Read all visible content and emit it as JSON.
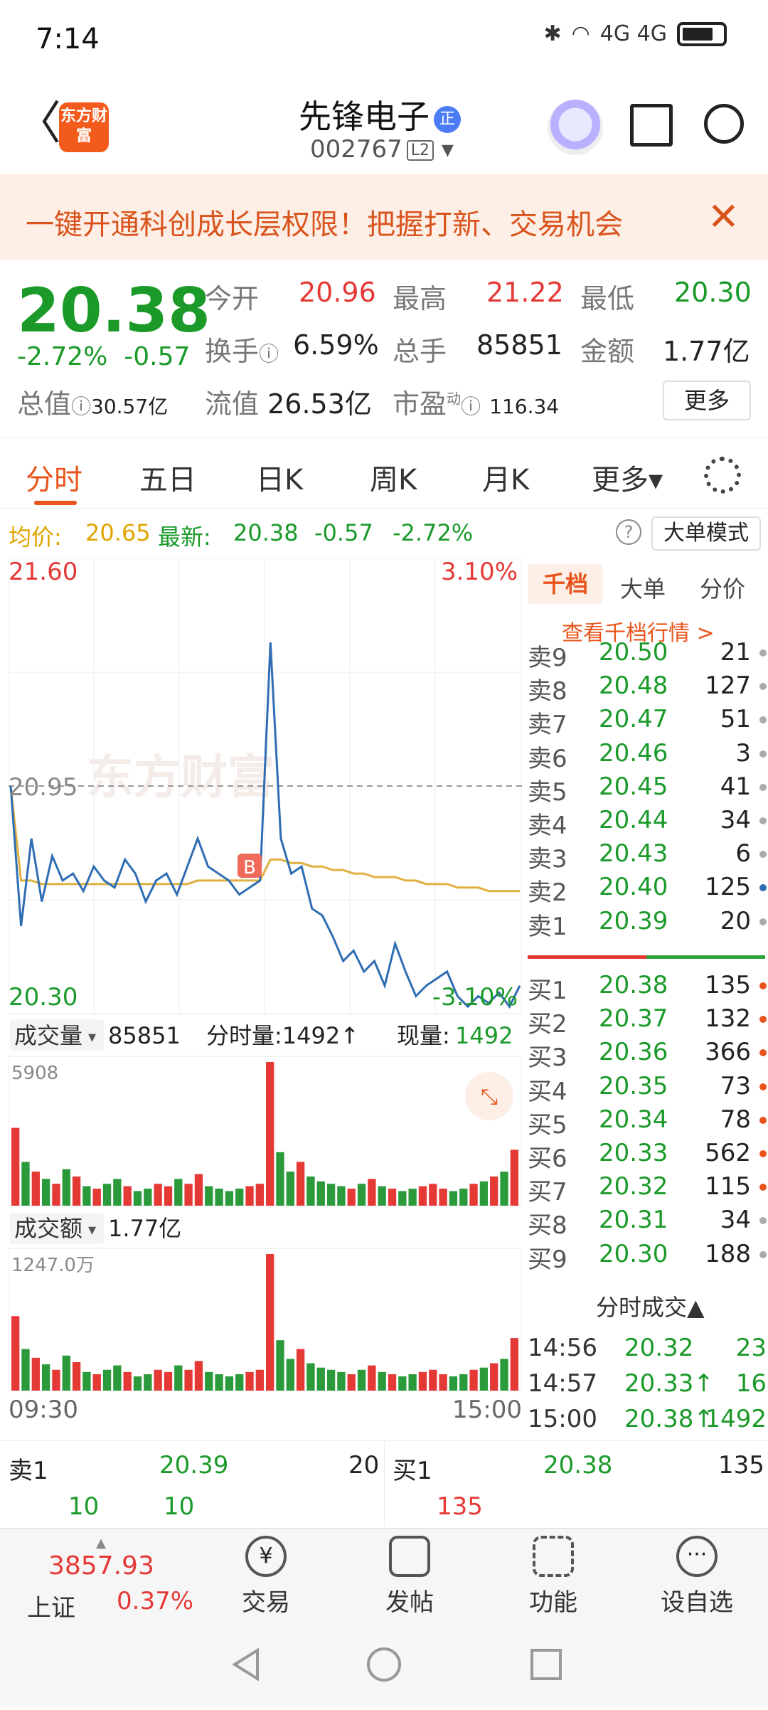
{
  "status": {
    "time": "7:14",
    "network": "4G 4G"
  },
  "header": {
    "back": "〈",
    "logo_text": "东方财富",
    "stock_name": "先锋电子",
    "badge": "正",
    "code": "002767",
    "level": "L2"
  },
  "banner": {
    "text": "一键开通科创成长层权限！把握打新、交易机会",
    "close": "✕"
  },
  "quote": {
    "price": "20.38",
    "change_pct": "-2.72%",
    "change": "-0.57",
    "open_label": "今开",
    "open": "20.96",
    "high_label": "最高",
    "high": "21.22",
    "low_label": "最低",
    "low": "20.30",
    "turnover_label": "换手",
    "turnover": "6.59%",
    "volume_label": "总手",
    "volume": "85851",
    "amount_label": "金额",
    "amount": "1.77亿",
    "mktcap_label": "总值",
    "mktcap": "30.57亿",
    "float_label": "流值",
    "float": "26.53亿",
    "pe_label": "市盈",
    "pe_sup": "动",
    "pe": "116.34",
    "more": "更多"
  },
  "tabs": [
    "分时",
    "五日",
    "日K",
    "周K",
    "月K",
    "更多▾"
  ],
  "infobar": {
    "avg_label": "均价:",
    "avg": "20.65",
    "latest_label": "最新:",
    "latest": "20.38",
    "chg": "-0.57",
    "pct": "-2.72%",
    "mode": "大单模式"
  },
  "chart_labels": {
    "top_price": "21.60",
    "top_pct": "3.10%",
    "mid_price": "20.95",
    "bot_price": "20.30",
    "bot_pct": "-3.10%",
    "watermark": "东方财富",
    "marker": "B",
    "vol_label": "成交量",
    "vol_total": "85851",
    "tick_label": "分时量:1492↑",
    "cur_label": "现量:",
    "cur_val": "1492",
    "vol_max": "5908",
    "amt_label": "成交额",
    "amt_total": "1.77亿",
    "amt_max": "1247.0万",
    "time_start": "09:30",
    "time_end": "15:00"
  },
  "chart_data": {
    "type": "line",
    "title": "",
    "ylim": [
      20.3,
      21.6
    ],
    "prev_close": 20.95,
    "xlabel_start": "09:30",
    "xlabel_end": "15:00",
    "price": [
      20.95,
      20.55,
      20.8,
      20.62,
      20.75,
      20.68,
      20.7,
      20.65,
      20.72,
      20.68,
      20.66,
      20.74,
      20.7,
      20.62,
      20.68,
      20.7,
      20.64,
      20.72,
      20.8,
      20.72,
      20.7,
      20.68,
      20.64,
      20.66,
      20.68,
      21.36,
      20.8,
      20.7,
      20.72,
      20.6,
      20.58,
      20.52,
      20.45,
      20.48,
      20.42,
      20.45,
      20.38,
      20.5,
      20.42,
      20.35,
      20.38,
      20.4,
      20.42,
      20.35,
      20.32,
      20.35,
      20.33,
      20.36,
      20.32,
      20.38
    ],
    "avg": [
      20.95,
      20.68,
      20.68,
      20.67,
      20.67,
      20.67,
      20.67,
      20.67,
      20.67,
      20.67,
      20.67,
      20.67,
      20.67,
      20.67,
      20.67,
      20.67,
      20.67,
      20.67,
      20.68,
      20.68,
      20.68,
      20.68,
      20.68,
      20.68,
      20.68,
      20.74,
      20.74,
      20.73,
      20.73,
      20.72,
      20.72,
      20.71,
      20.71,
      20.7,
      20.7,
      20.69,
      20.69,
      20.69,
      20.68,
      20.68,
      20.67,
      20.67,
      20.67,
      20.66,
      20.66,
      20.66,
      20.65,
      20.65,
      20.65,
      20.65
    ],
    "volume": [
      3200,
      1800,
      1400,
      1100,
      900,
      1500,
      1200,
      800,
      700,
      900,
      1100,
      800,
      600,
      700,
      900,
      800,
      1100,
      900,
      1300,
      800,
      700,
      600,
      700,
      800,
      900,
      5908,
      2200,
      1400,
      1800,
      1200,
      1000,
      900,
      800,
      700,
      900,
      1100,
      800,
      700,
      600,
      700,
      800,
      900,
      700,
      600,
      700,
      900,
      1000,
      1200,
      1400,
      2300
    ],
    "amount": [
      680,
      380,
      300,
      240,
      190,
      320,
      260,
      170,
      150,
      190,
      230,
      170,
      130,
      150,
      190,
      170,
      230,
      190,
      270,
      170,
      150,
      130,
      150,
      170,
      190,
      1247,
      460,
      290,
      380,
      250,
      210,
      190,
      170,
      150,
      190,
      230,
      170,
      150,
      130,
      150,
      170,
      190,
      150,
      130,
      150,
      190,
      210,
      250,
      290,
      480
    ]
  },
  "book": {
    "tabs": [
      "千档",
      "大单",
      "分价"
    ],
    "link": "查看千档行情 >",
    "sells": [
      {
        "lb": "卖9",
        "pr": "20.50",
        "vol": "21"
      },
      {
        "lb": "卖8",
        "pr": "20.48",
        "vol": "127"
      },
      {
        "lb": "卖7",
        "pr": "20.47",
        "vol": "51"
      },
      {
        "lb": "卖6",
        "pr": "20.46",
        "vol": "3"
      },
      {
        "lb": "卖5",
        "pr": "20.45",
        "vol": "41"
      },
      {
        "lb": "卖4",
        "pr": "20.44",
        "vol": "34"
      },
      {
        "lb": "卖3",
        "pr": "20.43",
        "vol": "6"
      },
      {
        "lb": "卖2",
        "pr": "20.40",
        "vol": "125"
      },
      {
        "lb": "卖1",
        "pr": "20.39",
        "vol": "20"
      }
    ],
    "buys": [
      {
        "lb": "买1",
        "pr": "20.38",
        "vol": "135"
      },
      {
        "lb": "买2",
        "pr": "20.37",
        "vol": "132"
      },
      {
        "lb": "买3",
        "pr": "20.36",
        "vol": "366"
      },
      {
        "lb": "买4",
        "pr": "20.35",
        "vol": "73"
      },
      {
        "lb": "买5",
        "pr": "20.34",
        "vol": "78"
      },
      {
        "lb": "买6",
        "pr": "20.33",
        "vol": "562"
      },
      {
        "lb": "买7",
        "pr": "20.32",
        "vol": "115"
      },
      {
        "lb": "买8",
        "pr": "20.31",
        "vol": "34"
      },
      {
        "lb": "买9",
        "pr": "20.30",
        "vol": "188"
      }
    ],
    "trades_header": "分时成交▲",
    "trades": [
      {
        "t": "14:56",
        "p": "20.32",
        "v": "23"
      },
      {
        "t": "14:57",
        "p": "20.33↑",
        "v": "16"
      },
      {
        "t": "15:00",
        "p": "20.38↑",
        "v": "1492"
      }
    ]
  },
  "bottom5": {
    "sell_label": "卖1",
    "sell_price": "20.39",
    "sell_vol": "20",
    "sell_q1": "10",
    "sell_q2": "10",
    "buy_label": "买1",
    "buy_price": "20.38",
    "buy_vol": "135",
    "buy_q1": "135"
  },
  "tabbar": {
    "index_value": "3857.93",
    "index_name": "上证",
    "index_pct": "0.37%",
    "trade": "交易",
    "post": "发帖",
    "func": "功能",
    "watch": "设自选"
  },
  "colors": {
    "up": "#e53935",
    "down": "#1b9a2a",
    "avg": "#e0a400",
    "price_line": "#2f6db3",
    "accent": "#e8541c"
  }
}
